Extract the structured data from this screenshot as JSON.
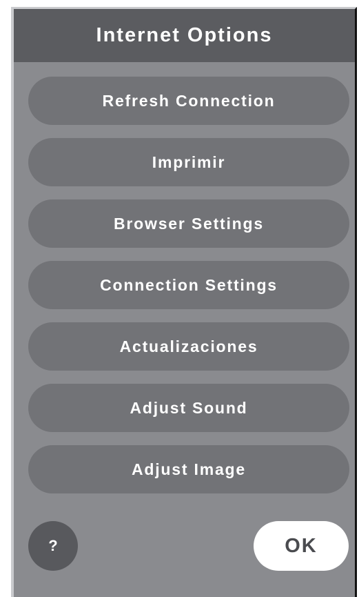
{
  "dialog": {
    "title": "Internet Options"
  },
  "menu": {
    "items": [
      {
        "label": "Refresh Connection"
      },
      {
        "label": "Imprimir"
      },
      {
        "label": "Browser Settings"
      },
      {
        "label": "Connection Settings"
      },
      {
        "label": "Actualizaciones"
      },
      {
        "label": "Adjust Sound"
      },
      {
        "label": "Adjust Image"
      }
    ]
  },
  "footer": {
    "help_label": "?",
    "ok_label": "OK"
  },
  "colors": {
    "dialog_bg": "#8a8b8f",
    "titlebar_bg": "#5b5c60",
    "button_bg": "#727377",
    "help_bg": "#58595d",
    "ok_bg": "#ffffff",
    "text_light": "#ffffff",
    "text_dark": "#4a4b4f"
  }
}
